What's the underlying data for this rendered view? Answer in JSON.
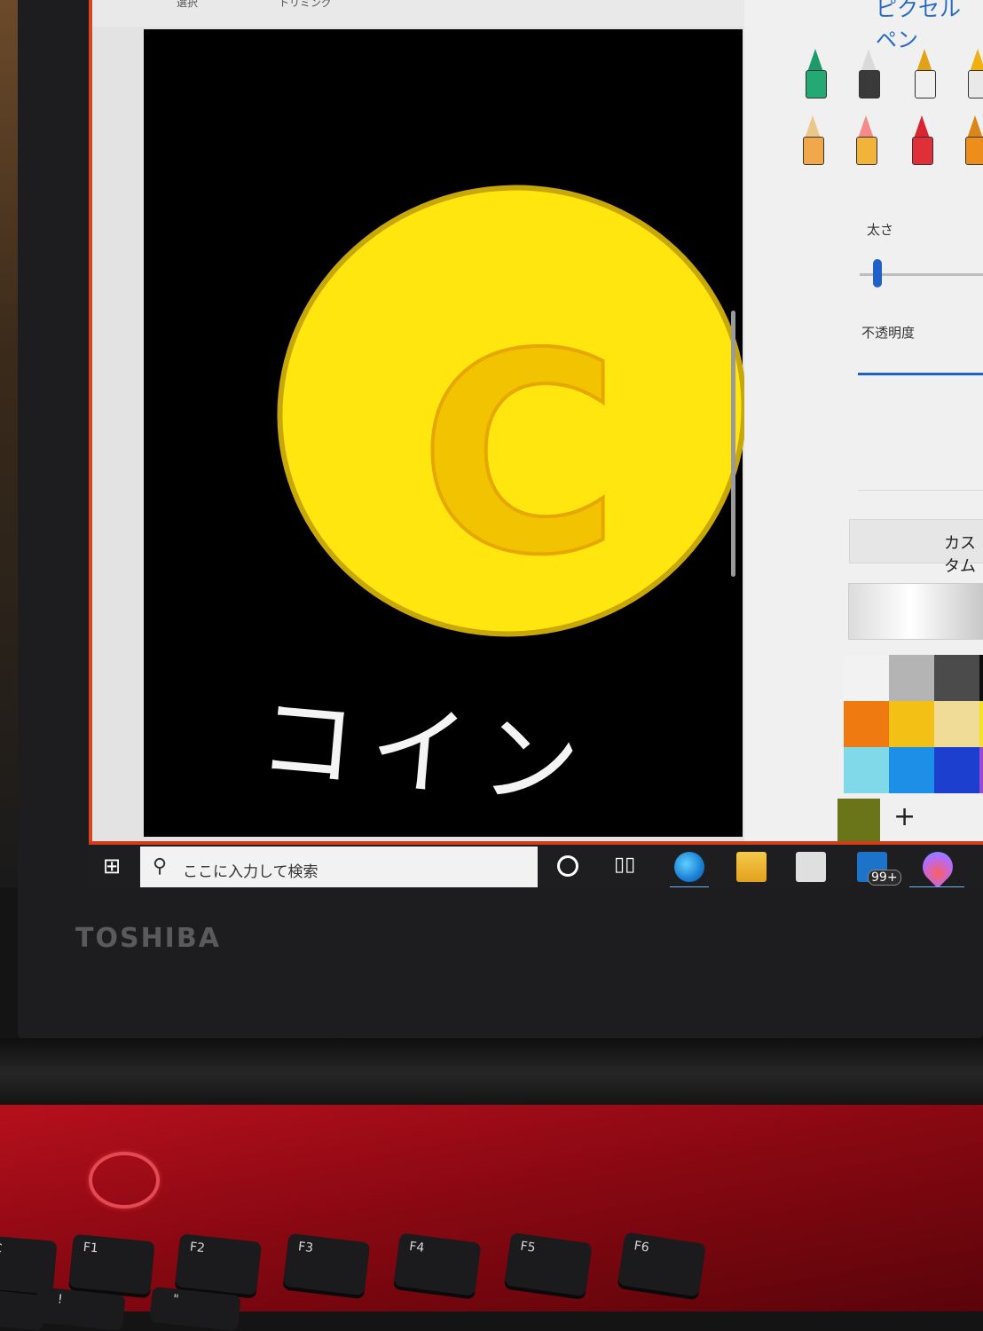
{
  "device": {
    "brand_logo": "TOSHIBA"
  },
  "paint_app": {
    "toolbar": {
      "items": [
        "選択",
        "トリミング"
      ]
    },
    "canvas": {
      "caption_text": "コイン",
      "coin_letter": "C"
    },
    "side_panel": {
      "title": "ピクセル ペン",
      "brushes": [
        "marker",
        "calligraphy-pen",
        "oil-brush",
        "watercolor",
        "pencil",
        "eraser",
        "crayon",
        "spray-can"
      ],
      "size_label": "太さ",
      "size_value_fraction": 0.1,
      "opacity_label": "不透明度",
      "opacity_value_fraction": 1.0,
      "custom_button_label": "カスタム",
      "palette": [
        [
          "#f2f2f2",
          "#b4b4b4",
          "#4b4b4b",
          "#0e0e0e",
          "#7a1208"
        ],
        [
          "#ef7a10",
          "#f3c116",
          "#f0dc96",
          "#f4e12a",
          "#bfe21c"
        ],
        [
          "#7fd9e8",
          "#1d8fe6",
          "#1c3fd0",
          "#9a4ad0",
          "#f0a2bc"
        ]
      ],
      "current_color": "#6a7418",
      "add_color_label": "+"
    }
  },
  "taskbar": {
    "search_placeholder": "ここに入力して検索",
    "mail_badge": "99+",
    "accent": "#cf3d1b"
  },
  "keyboard": {
    "function_keys": [
      "SC",
      "F1",
      "F2",
      "F3",
      "F4",
      "F5",
      "F6"
    ],
    "second_row": [
      "",
      "!",
      "\""
    ]
  }
}
